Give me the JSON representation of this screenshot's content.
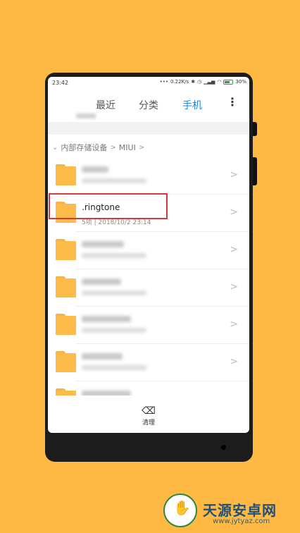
{
  "status_bar": {
    "time": "23:42",
    "network_speed": "0.22K/s",
    "battery_percent": "30%"
  },
  "tabs": [
    {
      "label": "最近",
      "active": false
    },
    {
      "label": "分类",
      "active": false
    },
    {
      "label": "手机",
      "active": true
    }
  ],
  "more_icon": "⋮",
  "breadcrumb": {
    "chevron": "⌄",
    "storage": "内部存储设备",
    "folder": "MIUI"
  },
  "rows": [
    {
      "blurred": true
    },
    {
      "blurred": false,
      "name": ".ringtone",
      "count": "5项",
      "date": "2018/10/2 23:14",
      "highlighted": true
    },
    {
      "blurred": true
    },
    {
      "blurred": true
    },
    {
      "blurred": true
    },
    {
      "blurred": true
    }
  ],
  "clean_button": {
    "label": "清理",
    "icon": "broom-icon"
  },
  "watermark": {
    "title": "天源安卓网",
    "url": "www.jytyaz.com",
    "logo_icon": "android-logo-icon"
  },
  "colors": {
    "background": "#FDB944",
    "accent": "#1E88E5",
    "folder": "#FDBB4A",
    "highlight": "#D33A3A"
  }
}
